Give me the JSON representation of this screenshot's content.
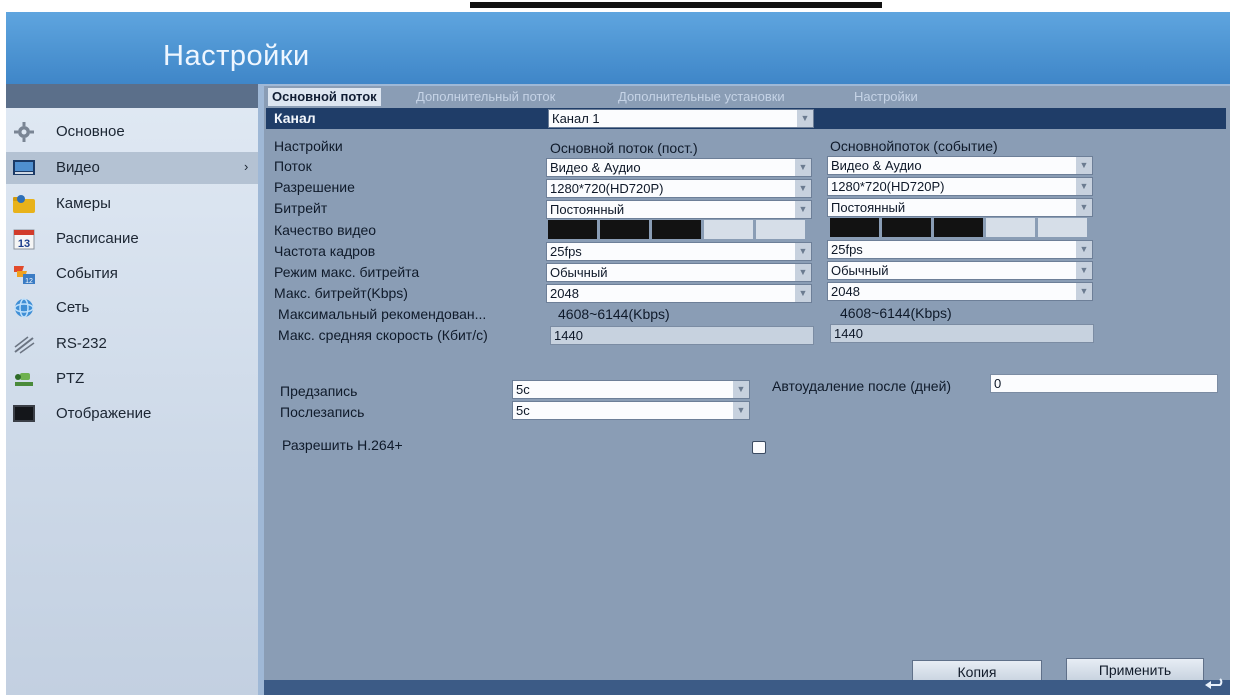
{
  "window": {
    "title": "Настройки"
  },
  "sidebar": {
    "items": [
      {
        "label": "Основное",
        "icon": "gear-icon",
        "active": false
      },
      {
        "label": "Видео",
        "icon": "video-icon",
        "active": true,
        "arrow": "›"
      },
      {
        "label": "Камеры",
        "icon": "camera-folder-icon",
        "active": false
      },
      {
        "label": "Расписание",
        "icon": "calendar-icon",
        "active": false
      },
      {
        "label": "События",
        "icon": "event-icon",
        "active": false
      },
      {
        "label": "Сеть",
        "icon": "network-icon",
        "active": false
      },
      {
        "label": "RS-232",
        "icon": "rs232-icon",
        "active": false
      },
      {
        "label": "PTZ",
        "icon": "ptz-icon",
        "active": false
      },
      {
        "label": "Отображение",
        "icon": "display-icon",
        "active": false
      }
    ]
  },
  "tabs": [
    {
      "label": "Основной поток",
      "active": true
    },
    {
      "label": "Дополнительный поток",
      "active": false
    },
    {
      "label": "Дополнительные установки",
      "active": false
    },
    {
      "label": "Настройки",
      "active": false
    }
  ],
  "channel": {
    "label": "Канал",
    "value": "Канал 1"
  },
  "settings": {
    "header_label": "Настройки",
    "col1_header": "Основной поток (пост.)",
    "col2_header": "Основнойпоток (событие)",
    "rows": {
      "stream": {
        "label": "Поток",
        "col1": "Видео & Аудио",
        "col2": "Видео & Аудио"
      },
      "resolution": {
        "label": "Разрешение",
        "col1": "1280*720(HD720P)",
        "col2": "1280*720(HD720P)"
      },
      "bitrate_type": {
        "label": "Битрейт",
        "col1": "Постоянный",
        "col2": "Постоянный"
      },
      "quality": {
        "label": "Качество видео",
        "col1_level": 3,
        "col2_level": 3,
        "segments": 5
      },
      "fps": {
        "label": "Частота кадров",
        "col1": "25fps",
        "col2": "25fps"
      },
      "max_bitrate_mode": {
        "label": "Режим макс. битрейта",
        "col1": "Обычный",
        "col2": "Обычный"
      },
      "max_bitrate": {
        "label": "Макс. битрейт(Kbps)",
        "col1": "2048",
        "col2": "2048"
      },
      "recommended": {
        "label": "Максимальный рекомендован...",
        "col1": "4608~6144(Kbps)",
        "col2": "4608~6144(Kbps)"
      },
      "avg_speed": {
        "label": "Макс. средняя скорость (Кбит/с)",
        "col1": "1440",
        "col2": "1440"
      }
    }
  },
  "record": {
    "pre": {
      "label": "Предзапись",
      "value": "5с"
    },
    "post": {
      "label": "Послезапись",
      "value": "5с"
    },
    "auto_delete": {
      "label": "Автоудаление после (дней)",
      "value": "0"
    },
    "h264plus": {
      "label": "Разрешить H.264+",
      "checked": false
    }
  },
  "buttons": {
    "copy": "Копия",
    "apply": "Применить"
  },
  "colors": {
    "title_bar": "#4d94d2",
    "channel_bar": "#1f3d68",
    "panel": "#8a9db5"
  }
}
